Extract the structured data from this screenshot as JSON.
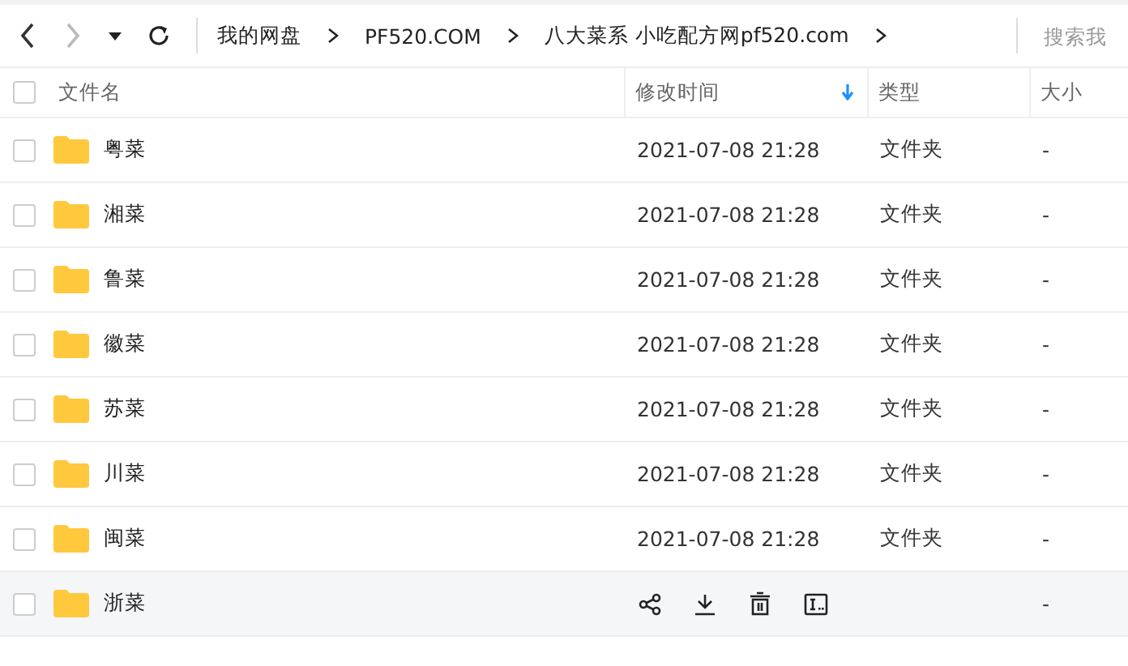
{
  "breadcrumb": [
    "我的网盘",
    "PF520.COM",
    "八大菜系 小吃配方网pf520.com"
  ],
  "search": {
    "placeholder": "搜索我"
  },
  "table": {
    "all_checked": false,
    "columns": [
      {
        "label": "文件名",
        "sorted": false
      },
      {
        "label": "修改时间",
        "sorted": true
      },
      {
        "label": "类型",
        "sorted": false
      },
      {
        "label": "大小",
        "sorted": false
      }
    ],
    "rows": [
      {
        "name": "粤菜",
        "modified": "2021-07-08 21:28",
        "type": "文件夹",
        "size": "-",
        "hovered": false,
        "checked": false
      },
      {
        "name": "湘菜",
        "modified": "2021-07-08 21:28",
        "type": "文件夹",
        "size": "-",
        "hovered": false,
        "checked": false
      },
      {
        "name": "鲁菜",
        "modified": "2021-07-08 21:28",
        "type": "文件夹",
        "size": "-",
        "hovered": false,
        "checked": false
      },
      {
        "name": "徽菜",
        "modified": "2021-07-08 21:28",
        "type": "文件夹",
        "size": "-",
        "hovered": false,
        "checked": false
      },
      {
        "name": "苏菜",
        "modified": "2021-07-08 21:28",
        "type": "文件夹",
        "size": "-",
        "hovered": false,
        "checked": false
      },
      {
        "name": "川菜",
        "modified": "2021-07-08 21:28",
        "type": "文件夹",
        "size": "-",
        "hovered": false,
        "checked": false
      },
      {
        "name": "闽菜",
        "modified": "2021-07-08 21:28",
        "type": "文件夹",
        "size": "-",
        "hovered": false,
        "checked": false
      },
      {
        "name": "浙菜",
        "size": "-",
        "hovered": true,
        "checked": false
      }
    ]
  }
}
